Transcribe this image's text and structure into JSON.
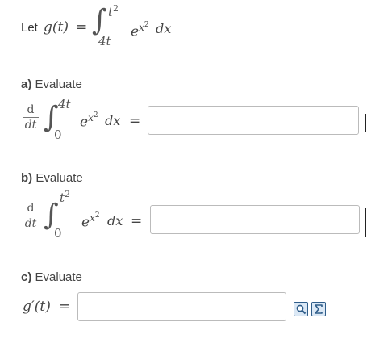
{
  "definition": {
    "prefix": "Let",
    "func": "g(t)",
    "eq": "=",
    "upper": "t",
    "upper_exp": "2",
    "lower": "4t",
    "integrand_base": "e",
    "integrand_exp": "x",
    "integrand_exp2": "2",
    "dx": "dx"
  },
  "part_a": {
    "label": "a)",
    "label_rest": "Evaluate",
    "d": "d",
    "dt": "dt",
    "upper": "4t",
    "lower": "0",
    "eq": "=",
    "answer": ""
  },
  "part_b": {
    "label": "b)",
    "label_rest": "Evaluate",
    "d": "d",
    "dt": "dt",
    "upper": "t",
    "upper_exp": "2",
    "lower": "0",
    "eq": "=",
    "answer": ""
  },
  "part_c": {
    "label": "c)",
    "label_rest": "Evaluate",
    "lhs": "g′(t)",
    "eq": "=",
    "answer": ""
  },
  "icons": {
    "preview": "magnifier-preview-icon",
    "equation_editor": "sigma-equation-icon"
  }
}
